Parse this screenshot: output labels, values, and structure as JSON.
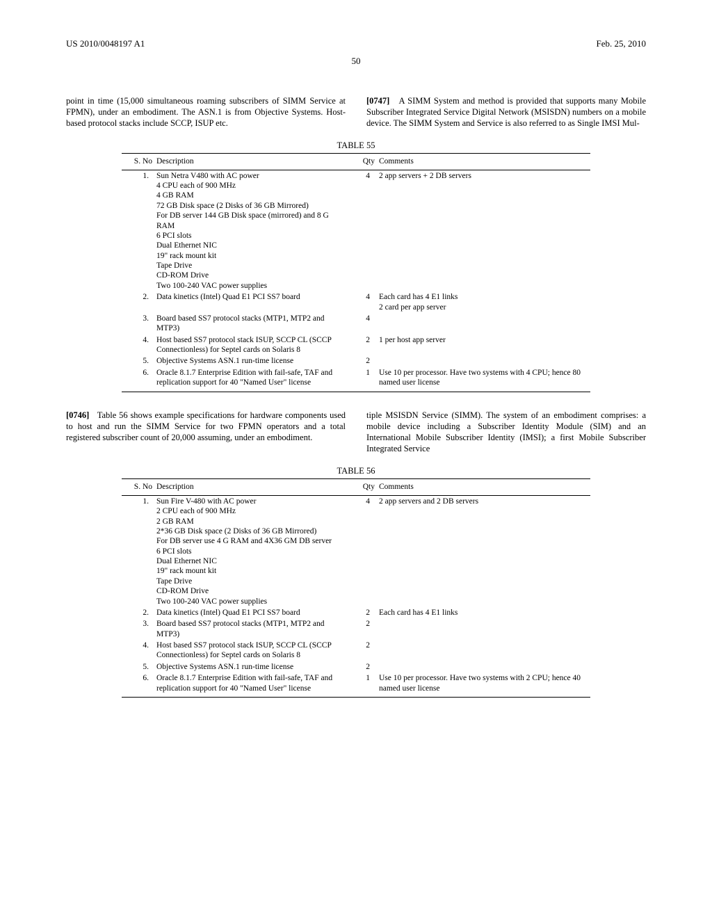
{
  "header": {
    "pub_number": "US 2010/0048197 A1",
    "pub_date": "Feb. 25, 2010",
    "page_number": "50"
  },
  "para_top_left": "point in time (15,000 simultaneous roaming subscribers of SIMM Service at FPMN), under an embodiment. The ASN.1 is from Objective Systems. Host-based protocol stacks include SCCP, ISUP etc.",
  "para_top_right_num": "[0747]",
  "para_top_right": "A SIMM System and method is provided that supports many Mobile Subscriber Integrated Service Digital Network (MSISDN) numbers on a mobile device. The SIMM System and Service is also referred to as Single IMSI Mul-",
  "table55": {
    "caption": "TABLE 55",
    "headers": {
      "sno": "S. No",
      "desc": "Description",
      "qty": "Qty",
      "comm": "Comments"
    },
    "rows": [
      {
        "sno": "1.",
        "desc": "Sun Netra V480 with AC power\n4 CPU each of 900 MHz\n4 GB RAM\n72 GB Disk space (2 Disks of 36 GB Mirrored)\nFor DB server 144 GB Disk space (mirrored) and 8 G RAM\n6 PCI slots\nDual Ethernet NIC\n19\" rack mount kit\nTape Drive\nCD-ROM Drive\nTwo 100-240 VAC power supplies",
        "qty": "4",
        "comm": "2 app servers + 2 DB servers"
      },
      {
        "sno": "2.",
        "desc": "Data kinetics (Intel) Quad E1 PCI SS7 board",
        "qty": "4",
        "comm": "Each card has 4 E1 links\n2 card per app server"
      },
      {
        "sno": "3.",
        "desc": "Board based SS7 protocol stacks (MTP1, MTP2 and MTP3)",
        "qty": "4",
        "comm": ""
      },
      {
        "sno": "4.",
        "desc": "Host based SS7 protocol stack ISUP, SCCP CL (SCCP Connectionless) for Septel cards on Solaris 8",
        "qty": "2",
        "comm": "1 per host app server"
      },
      {
        "sno": "5.",
        "desc": "Objective Systems ASN.1 run-time license",
        "qty": "2",
        "comm": ""
      },
      {
        "sno": "6.",
        "desc": "Oracle 8.1.7 Enterprise Edition with fail-safe, TAF and replication support for 40 \"Named User\" license",
        "qty": "1",
        "comm": "Use 10 per processor. Have two systems with 4 CPU; hence 80 named user license"
      }
    ]
  },
  "para_mid_left_num": "[0746]",
  "para_mid_left": "Table 56 shows example specifications for hardware components used to host and run the SIMM Service for two FPMN operators and a total registered subscriber count of 20,000 assuming, under an embodiment.",
  "para_mid_right": "tiple MSISDN Service (SIMM). The system of an embodiment comprises: a mobile device including a Subscriber Identity Module (SIM) and an International Mobile Subscriber Identity (IMSI); a first Mobile Subscriber Integrated Service",
  "table56": {
    "caption": "TABLE 56",
    "headers": {
      "sno": "S. No",
      "desc": "Description",
      "qty": "Qty",
      "comm": "Comments"
    },
    "rows": [
      {
        "sno": "1.",
        "desc": "Sun Fire V-480 with AC power\n2 CPU each of 900 MHz\n2 GB RAM\n2*36 GB Disk space (2 Disks of 36 GB Mirrored)\nFor DB server use 4 G RAM and 4X36 GM DB server\n6 PCI slots\nDual Ethernet NIC\n19\" rack mount kit\nTape Drive\nCD-ROM Drive\nTwo 100-240 VAC power supplies",
        "qty": "4",
        "comm": "2 app servers and 2 DB servers"
      },
      {
        "sno": "2.",
        "desc": "Data kinetics (Intel) Quad E1 PCI SS7 board",
        "qty": "2",
        "comm": "Each card has 4 E1 links"
      },
      {
        "sno": "3.",
        "desc": "Board based SS7 protocol stacks (MTP1, MTP2 and MTP3)",
        "qty": "2",
        "comm": ""
      },
      {
        "sno": "4.",
        "desc": "Host based SS7 protocol stack ISUP, SCCP CL (SCCP Connectionless) for Septel cards on Solaris 8",
        "qty": "2",
        "comm": ""
      },
      {
        "sno": "5.",
        "desc": "Objective Systems ASN.1 run-time license",
        "qty": "2",
        "comm": ""
      },
      {
        "sno": "6.",
        "desc": "Oracle 8.1.7 Enterprise Edition with fail-safe, TAF and replication support for 40 \"Named User\" license",
        "qty": "1",
        "comm": "Use 10 per processor. Have two systems with 2 CPU; hence 40 named user license"
      }
    ]
  }
}
